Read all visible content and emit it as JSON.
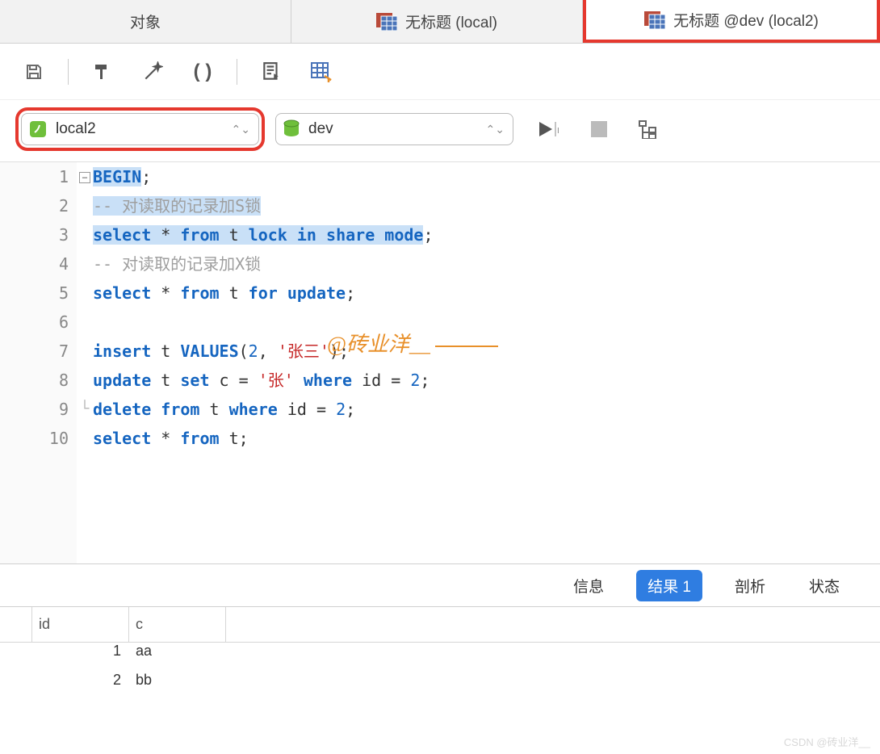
{
  "tabs": [
    {
      "label": "对象",
      "icon": ""
    },
    {
      "label": "无标题 (local)",
      "icon": "table-icon"
    },
    {
      "label": "无标题 @dev (local2)",
      "icon": "table-icon"
    }
  ],
  "selectors": {
    "connection": "local2",
    "database": "dev"
  },
  "code": {
    "lines": [
      {
        "n": 1,
        "fold": "-",
        "segs": [
          {
            "t": "BEGIN",
            "c": "kw",
            "hl": true
          },
          {
            "t": ";",
            "c": "pn"
          }
        ]
      },
      {
        "n": 2,
        "segs": [
          {
            "t": "-- 对读取的记录加S锁",
            "c": "cmt",
            "hl": true
          }
        ]
      },
      {
        "n": 3,
        "segs": [
          {
            "t": "select",
            "c": "kw",
            "hl": true
          },
          {
            "t": " * ",
            "c": "pn",
            "hl": true
          },
          {
            "t": "from",
            "c": "kw",
            "hl": true
          },
          {
            "t": " t ",
            "c": "pn",
            "hl": true
          },
          {
            "t": "lock",
            "c": "kw",
            "hl": true
          },
          {
            "t": " ",
            "c": "pn",
            "hl": true
          },
          {
            "t": "in",
            "c": "kw",
            "hl": true
          },
          {
            "t": " ",
            "c": "pn",
            "hl": true
          },
          {
            "t": "share",
            "c": "kw",
            "hl": true
          },
          {
            "t": " ",
            "c": "pn",
            "hl": true
          },
          {
            "t": "mode",
            "c": "kw",
            "hl": true
          },
          {
            "t": ";",
            "c": "pn"
          }
        ]
      },
      {
        "n": 4,
        "segs": [
          {
            "t": "-- 对读取的记录加X锁",
            "c": "cmt"
          }
        ]
      },
      {
        "n": 5,
        "segs": [
          {
            "t": "select",
            "c": "kw"
          },
          {
            "t": " * ",
            "c": "pn"
          },
          {
            "t": "from",
            "c": "kw"
          },
          {
            "t": " t ",
            "c": "pn"
          },
          {
            "t": "for",
            "c": "kw"
          },
          {
            "t": " ",
            "c": "pn"
          },
          {
            "t": "update",
            "c": "kw"
          },
          {
            "t": ";",
            "c": "pn"
          }
        ]
      },
      {
        "n": 6,
        "segs": [
          {
            "t": "",
            "c": "pn"
          }
        ]
      },
      {
        "n": 7,
        "segs": [
          {
            "t": "insert",
            "c": "kw"
          },
          {
            "t": " t ",
            "c": "pn"
          },
          {
            "t": "VALUES",
            "c": "kw"
          },
          {
            "t": "(",
            "c": "pn"
          },
          {
            "t": "2",
            "c": "num"
          },
          {
            "t": ", ",
            "c": "pn"
          },
          {
            "t": "'张三'",
            "c": "str"
          },
          {
            "t": ");",
            "c": "pn"
          }
        ]
      },
      {
        "n": 8,
        "segs": [
          {
            "t": "update",
            "c": "kw"
          },
          {
            "t": " t ",
            "c": "pn"
          },
          {
            "t": "set",
            "c": "kw"
          },
          {
            "t": " c = ",
            "c": "pn"
          },
          {
            "t": "'张'",
            "c": "str"
          },
          {
            "t": " ",
            "c": "pn"
          },
          {
            "t": "where",
            "c": "kw"
          },
          {
            "t": " id = ",
            "c": "pn"
          },
          {
            "t": "2",
            "c": "num"
          },
          {
            "t": ";",
            "c": "pn"
          }
        ]
      },
      {
        "n": 9,
        "fold": "L",
        "segs": [
          {
            "t": "delete",
            "c": "kw"
          },
          {
            "t": " ",
            "c": "pn"
          },
          {
            "t": "from",
            "c": "kw"
          },
          {
            "t": " t ",
            "c": "pn"
          },
          {
            "t": "where",
            "c": "kw"
          },
          {
            "t": " id = ",
            "c": "pn"
          },
          {
            "t": "2",
            "c": "num"
          },
          {
            "t": ";",
            "c": "pn"
          }
        ]
      },
      {
        "n": 10,
        "segs": [
          {
            "t": "select",
            "c": "kw"
          },
          {
            "t": " * ",
            "c": "pn"
          },
          {
            "t": "from",
            "c": "kw"
          },
          {
            "t": " t;",
            "c": "pn"
          }
        ]
      }
    ]
  },
  "watermark": "@砖业洋__",
  "result_tabs": [
    "信息",
    "结果 1",
    "剖析",
    "状态"
  ],
  "result_active": 1,
  "results": {
    "columns": [
      "id",
      "c"
    ],
    "rows": [
      {
        "id": "1",
        "c": "aa"
      },
      {
        "id": "2",
        "c": "bb"
      }
    ]
  },
  "footer_watermark": "CSDN @砖业洋__"
}
